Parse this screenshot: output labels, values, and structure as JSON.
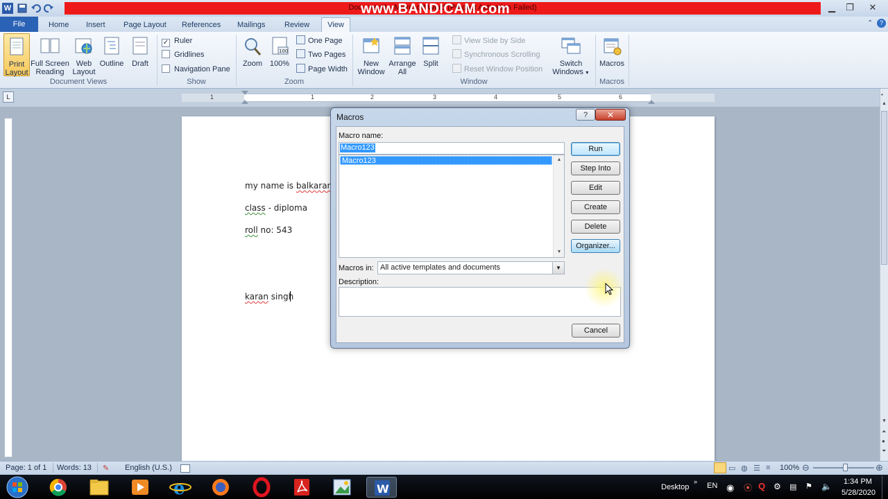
{
  "titlebar": {
    "title": "Document1 - Microsoft Word (Product Activation Failed)",
    "watermark": "www.BANDICAM.com"
  },
  "ribbon": {
    "tabs": [
      "File",
      "Home",
      "Insert",
      "Page Layout",
      "References",
      "Mailings",
      "Review",
      "View"
    ],
    "active_tab": "View",
    "groups": {
      "document_views": {
        "label": "Document Views",
        "buttons": [
          {
            "line1": "Print",
            "line2": "Layout"
          },
          {
            "line1": "Full Screen",
            "line2": "Reading"
          },
          {
            "line1": "Web",
            "line2": "Layout"
          },
          {
            "line1": "Outline",
            "line2": ""
          },
          {
            "line1": "Draft",
            "line2": ""
          }
        ]
      },
      "show": {
        "label": "Show",
        "ruler": "Ruler",
        "gridlines": "Gridlines",
        "navigation_pane": "Navigation Pane",
        "ruler_checked": true
      },
      "zoom": {
        "label": "Zoom",
        "zoom": "Zoom",
        "percent": "100%",
        "one_page": "One Page",
        "two_pages": "Two Pages",
        "page_width": "Page Width"
      },
      "window": {
        "label": "Window",
        "new_window_1": "New",
        "new_window_2": "Window",
        "arrange_1": "Arrange",
        "arrange_2": "All",
        "split": "Split",
        "view_side": "View Side by Side",
        "sync_scroll": "Synchronous Scrolling",
        "reset_pos": "Reset Window Position",
        "switch_1": "Switch",
        "switch_2": "Windows"
      },
      "macros": {
        "label": "Macros",
        "button": "Macros"
      }
    }
  },
  "ruler": {
    "numbers": [
      "1",
      "1",
      "2",
      "3",
      "4",
      "5",
      "6"
    ]
  },
  "document": {
    "lines": [
      {
        "pre": "my name is ",
        "squig": "balkaran",
        "post": " s"
      },
      {
        "pre": "",
        "squig": "class",
        "post": " - diploma"
      },
      {
        "pre": "",
        "squig": "roll",
        "post": " no: 543"
      },
      {
        "pre": "",
        "squig": "karan",
        "post": " singh"
      }
    ]
  },
  "dialog": {
    "title": "Macros",
    "help": "?",
    "close": "✕",
    "macro_name_label": "Macro name:",
    "macro_name_value": "Macro123",
    "macro_list": [
      "Macro123"
    ],
    "macros_in_label": "Macros in:",
    "macros_in_value": "All active templates and documents",
    "description_label": "Description:",
    "buttons": {
      "run": "Run",
      "step_into": "Step Into",
      "edit": "Edit",
      "create": "Create",
      "delete": "Delete",
      "organizer": "Organizer...",
      "cancel": "Cancel"
    }
  },
  "statusbar": {
    "page": "Page: 1 of 1",
    "words": "Words: 13",
    "language": "English (U.S.)",
    "zoom": "100%"
  },
  "taskbar": {
    "desktop": "Desktop",
    "lang": "EN",
    "time": "1:34 PM",
    "date": "5/28/2020"
  },
  "colors": {
    "file_tab": "#2a62b6",
    "selection": "#3399ff",
    "recording_banner": "#ee1a1a"
  }
}
